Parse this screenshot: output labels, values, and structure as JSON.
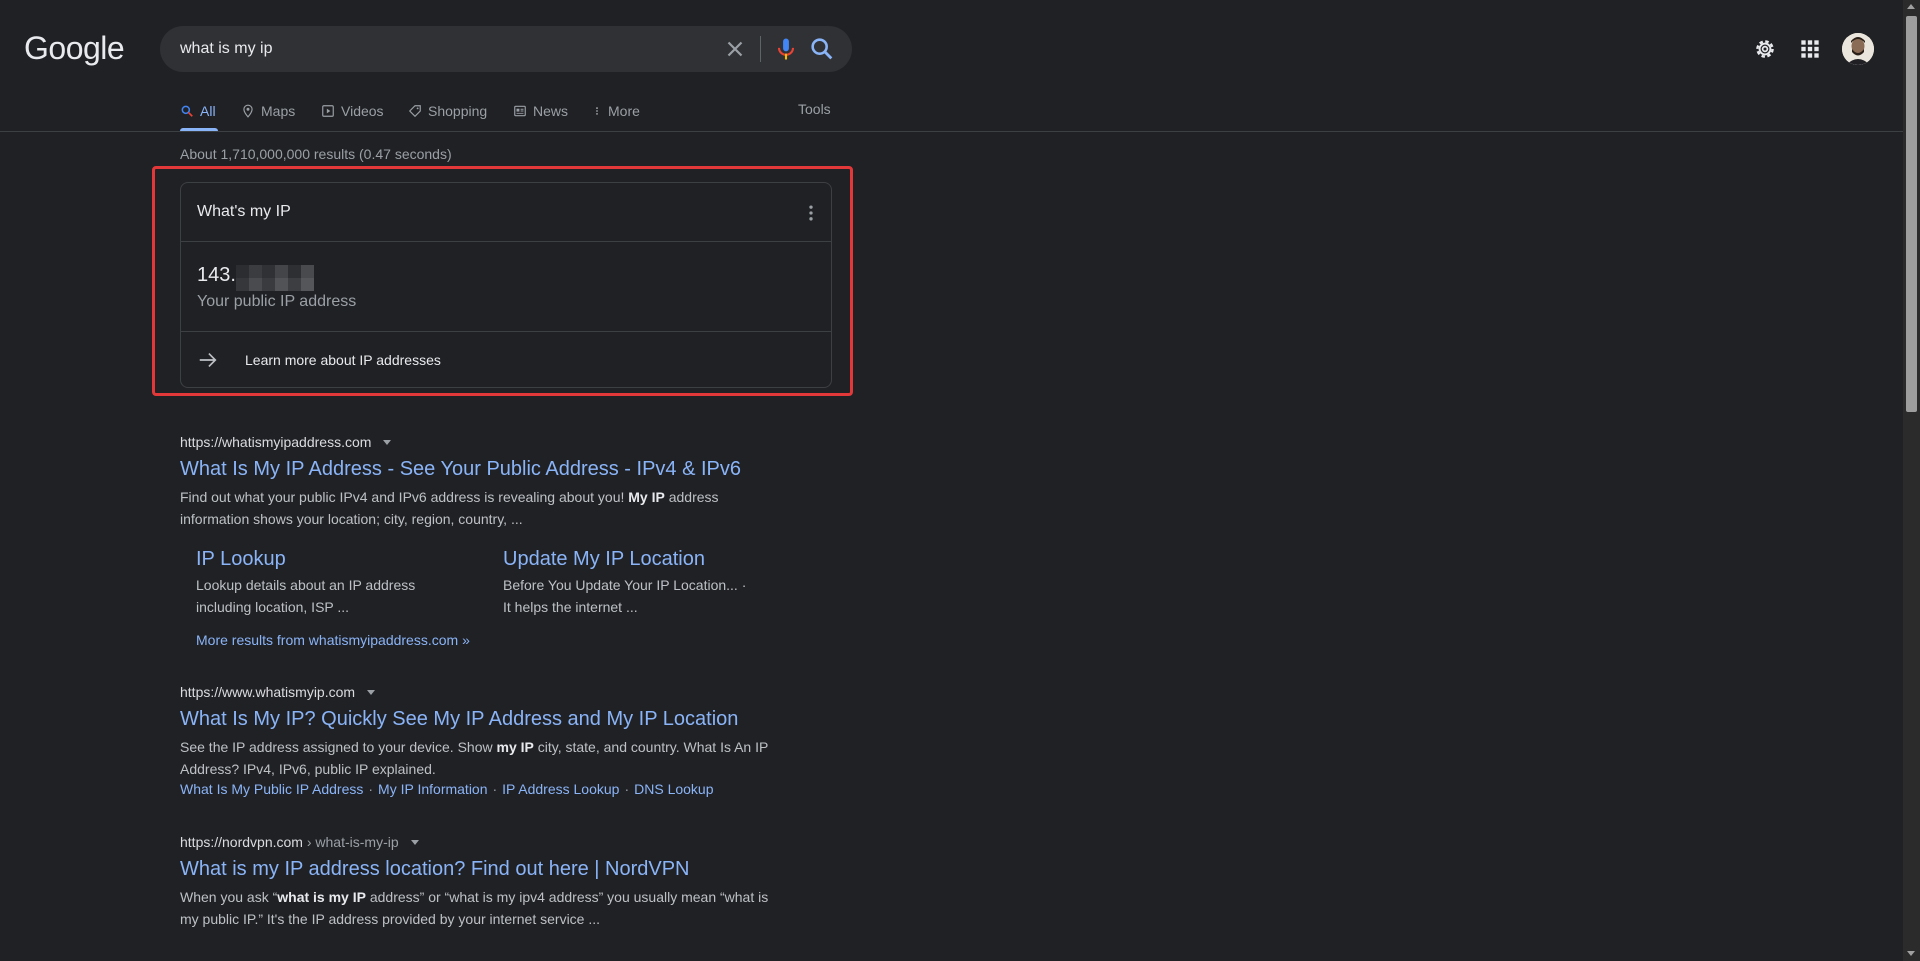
{
  "header": {
    "logo": "Google",
    "search_value": "what is my ip",
    "icons": [
      "close-icon",
      "mic-icon",
      "search-icon",
      "gear-icon",
      "apps-icon",
      "avatar"
    ]
  },
  "tabs": [
    {
      "label": "All",
      "active": true,
      "icon": "search-icon"
    },
    {
      "label": "Maps",
      "icon": "pin-icon"
    },
    {
      "label": "Videos",
      "icon": "play-icon"
    },
    {
      "label": "Shopping",
      "icon": "tag-icon"
    },
    {
      "label": "News",
      "icon": "newspaper-icon"
    },
    {
      "label": "More",
      "icon": "dots-vertical-icon"
    }
  ],
  "tools_label": "Tools",
  "result_stats": "About 1,710,000,000 results (0.47 seconds)",
  "ip_card": {
    "title": "What's my IP",
    "ip_prefix": "143.",
    "ip_label": "Your public IP address",
    "learn_more": "Learn more about IP addresses"
  },
  "results": [
    {
      "url": "https://whatismyipaddress.com",
      "title": "What Is My IP Address - See Your Public Address - IPv4 & IPv6",
      "snippet_pre": "Find out what your public IPv4 and IPv6 address is revealing about you! ",
      "snippet_bold": "My IP",
      "snippet_post": " address information shows your location; city, region, country, ...",
      "sitelinks": [
        {
          "title": "IP Lookup",
          "snippet": "Lookup details about an IP address including location, ISP ..."
        },
        {
          "title": "Update My IP Location",
          "snippet": "Before You Update Your IP Location... · It helps the internet ..."
        }
      ],
      "more_results": "More results from whatismyipaddress.com »"
    },
    {
      "url": "https://www.whatismyip.com",
      "title": "What Is My IP? Quickly See My IP Address and My IP Location",
      "snippet_pre": "See the IP address assigned to your device. Show ",
      "snippet_bold": "my IP",
      "snippet_post": " city, state, and country. What Is An IP Address? IPv4, IPv6, public IP explained.",
      "sub_links": [
        "What Is My Public IP Address",
        "My IP Information",
        "IP Address Lookup",
        "DNS Lookup"
      ]
    },
    {
      "url": "https://nordvpn.com",
      "crumb": "› what-is-my-ip",
      "title": "What is my IP address location? Find out here | NordVPN",
      "snippet_pre": "When you ask “",
      "snippet_bold": "what is my IP",
      "snippet_post": " address” or “what is my ipv4 address” you usually mean “what is my public IP.” It's the IP address provided by your internet service ..."
    }
  ],
  "colors": {
    "background": "#202124",
    "link": "#8ab4f8",
    "highlight_border": "#e2383a"
  }
}
